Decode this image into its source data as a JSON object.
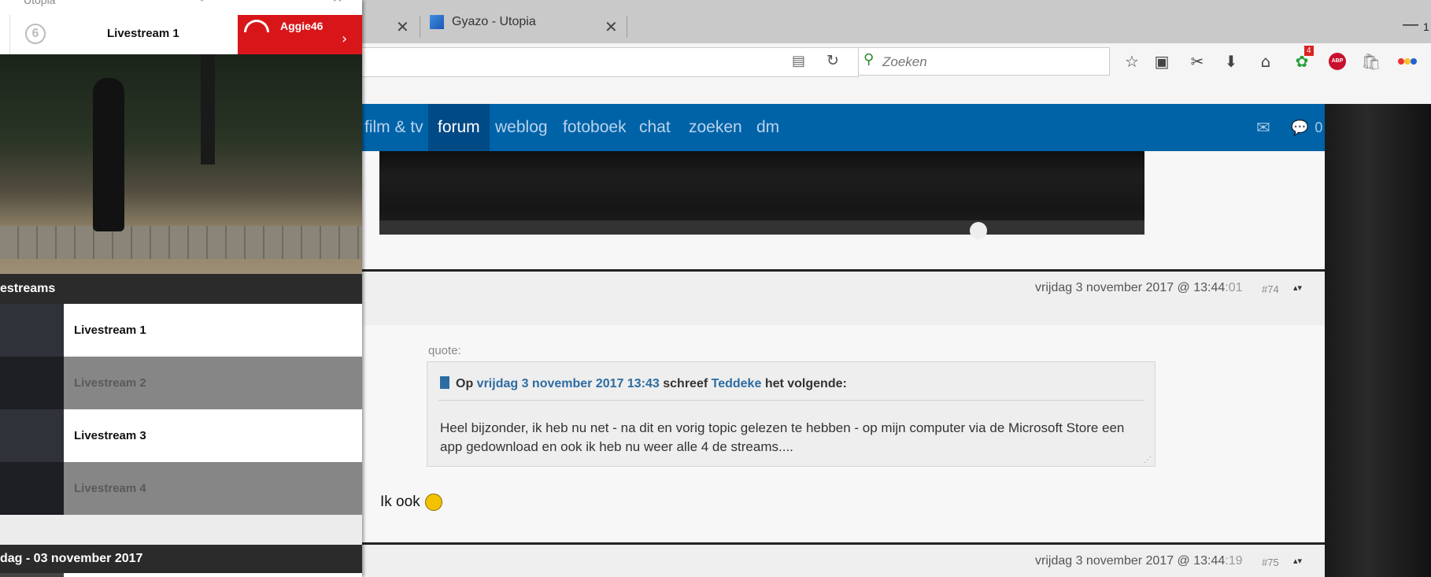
{
  "browser": {
    "tabs": [
      {
        "label": ""
      },
      {
        "label": "Gyazo - Utopia"
      }
    ],
    "window_hint": "1"
  },
  "search": {
    "placeholder": "Zoeken"
  },
  "toolbar": {
    "badge_count": "4",
    "abp_label": "ABP"
  },
  "site_nav": {
    "items": [
      "film & tv",
      "forum",
      "weblog",
      "fotoboek",
      "chat",
      "zoeken",
      "dm"
    ],
    "active": "forum",
    "comments_count": "0"
  },
  "posts": [
    {
      "date": "vrijdag 3 november 2017 @ 13:44",
      "seconds": ":01",
      "number": "#74"
    },
    {
      "date": "vrijdag 3 november 2017 @ 13:44",
      "seconds": ":19",
      "number": "#75"
    }
  ],
  "quote": {
    "label": "quote:",
    "op": "Op",
    "date_link": "vrijdag 3 november 2017 13:43",
    "wrote": "schreef",
    "author": "Teddeke",
    "rest": "het volgende:",
    "body": "Heel bijzonder, ik heb nu net - na dit en vorig topic gelezen te hebben - op mijn computer via de Microsoft Store een app gedownload en ook ik heb nu weer alle 4 de streams...."
  },
  "reply": {
    "text": "Ik ook"
  },
  "popup": {
    "window_title": "Utopia",
    "current_stream": "Livestream 1",
    "user": "Aggie46",
    "section_title": "estreams",
    "streams": [
      "Livestream 1",
      "Livestream 2",
      "Livestream 3",
      "Livestream 4"
    ],
    "date_header": "dag - 03 november 2017"
  },
  "colors": {
    "site_nav": "#0063a8",
    "site_nav_active": "#004a86",
    "popup_red": "#d8161a",
    "link": "#2d6ca2"
  }
}
